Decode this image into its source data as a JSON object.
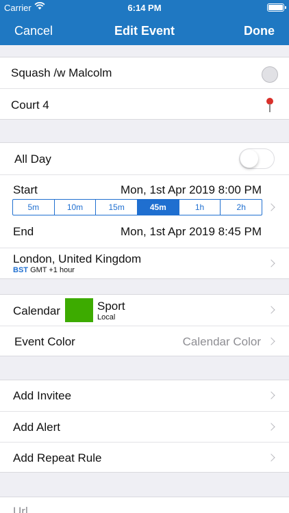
{
  "status_bar": {
    "carrier": "Carrier",
    "time": "6:14 PM"
  },
  "nav": {
    "cancel": "Cancel",
    "title": "Edit Event",
    "done": "Done"
  },
  "event": {
    "title": "Squash /w Malcolm",
    "location": "Court 4"
  },
  "timing": {
    "all_day_label": "All Day",
    "all_day_on": false,
    "start_label": "Start",
    "start_value": "Mon, 1st Apr 2019 8:00 PM",
    "durations": [
      "5m",
      "10m",
      "15m",
      "45m",
      "1h",
      "2h"
    ],
    "selected_duration": "45m",
    "end_label": "End",
    "end_value": "Mon, 1st Apr 2019 8:45 PM",
    "timezone": {
      "name": "London, United Kingdom",
      "abbr": "BST",
      "offset": "GMT +1 hour"
    }
  },
  "calendar": {
    "label": "Calendar",
    "name": "Sport",
    "source": "Local",
    "swatch_color": "#3dab00",
    "event_color_label": "Event Color",
    "event_color_value": "Calendar Color"
  },
  "extras": {
    "add_invitee": "Add Invitee",
    "add_alert": "Add Alert",
    "add_repeat": "Add Repeat Rule"
  },
  "url": {
    "placeholder": "Url"
  },
  "colors": {
    "nav_bar": "#1f78c2",
    "accent": "#1f6fd0"
  }
}
